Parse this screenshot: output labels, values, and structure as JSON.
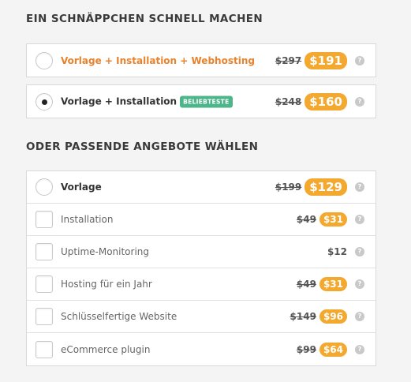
{
  "section1": {
    "title": "EIN SCHNÄPPCHEN SCHNELL MACHEN",
    "options": [
      {
        "label": "Vorlage + Installation + Webhosting",
        "old_price": "$297",
        "new_price": "$191",
        "checked": false
      },
      {
        "label": "Vorlage + Installation",
        "badge": "BELIEBTESTE",
        "old_price": "$248",
        "new_price": "$160",
        "checked": true
      }
    ]
  },
  "section2": {
    "title": "ODER PASSENDE ANGEBOTE WÄHLEN",
    "main": {
      "label": "Vorlage",
      "old_price": "$199",
      "new_price": "$129",
      "checked": false
    },
    "addons": [
      {
        "label": "Installation",
        "old_price": "$49",
        "new_price": "$31",
        "checked": false
      },
      {
        "label": "Uptime-Monitoring",
        "price": "$12",
        "checked": false
      },
      {
        "label": "Hosting für ein Jahr",
        "old_price": "$49",
        "new_price": "$31",
        "checked": false
      },
      {
        "label": "Schlüsselfertige Website",
        "old_price": "$149",
        "new_price": "$96",
        "checked": false
      },
      {
        "label": "eCommerce plugin",
        "old_price": "$99",
        "new_price": "$64",
        "checked": false
      }
    ]
  },
  "help_icon": {
    "name": "question-mark-icon",
    "glyph": "?"
  },
  "colors": {
    "accent_orange": "#f3a82f",
    "label_orange": "#e8822c",
    "badge_green": "#4cb58a"
  }
}
